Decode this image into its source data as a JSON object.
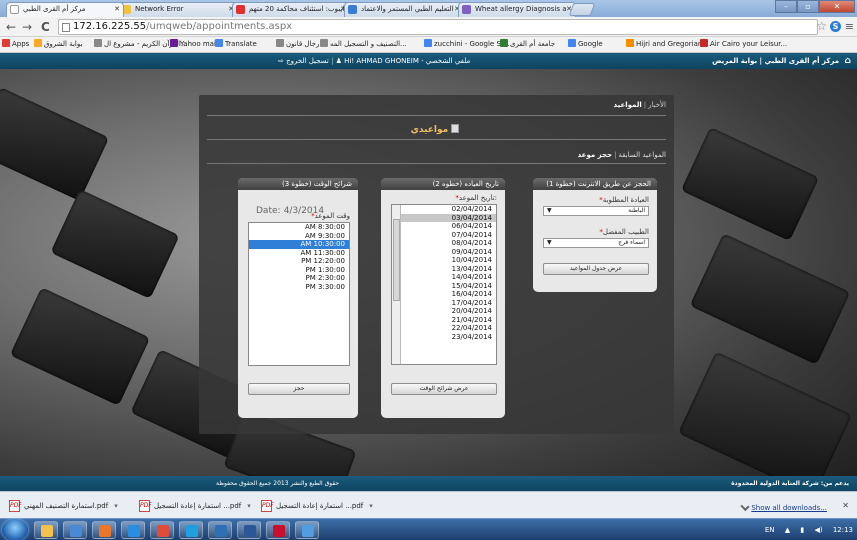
{
  "browser": {
    "tabs": [
      {
        "label": "مركز أم القرى الطبي",
        "icon_color": "#ffffff",
        "active": true
      },
      {
        "label": "Network Error",
        "icon_color": "#f0c040",
        "active": false
      },
      {
        "label": "ايبوب: استئناف محاكمة 20 متهم",
        "icon_color": "#e03030",
        "active": false
      },
      {
        "label": "التعليم الطبي المستمر والاعتماد",
        "icon_color": "#3a7bd5",
        "active": false
      },
      {
        "label": "Wheat allergy Diagnosis a",
        "icon_color": "#8060c0",
        "active": false
      }
    ],
    "window_controls": {
      "minimize": "–",
      "maximize": "▫",
      "close": "✕"
    },
    "nav": {
      "back": "←",
      "forward": "→",
      "reload": "C"
    },
    "url_host": "172.16.225.55",
    "url_path": "/umqweb/appointments.aspx",
    "star": "☆",
    "ext": "S",
    "menu": "≡",
    "bookmarks": [
      {
        "label": "Apps",
        "icon_color": "#e53935"
      },
      {
        "label": "بوابة الشروق",
        "icon_color": "#f9a825"
      },
      {
        "label": "القرآن الكريم - مشروع ال...",
        "icon_color": "#888888"
      },
      {
        "label": "Yahoo mail",
        "icon_color": "#6a1b9a"
      },
      {
        "label": "Translate",
        "icon_color": "#4285f4"
      },
      {
        "label": "رجال قانون",
        "icon_color": "#888888"
      },
      {
        "label": "التصنيف و التسجيل المه...",
        "icon_color": "#888888"
      },
      {
        "label": "zucchini - Google Se...",
        "icon_color": "#4285f4"
      },
      {
        "label": "جامعة أم القرى",
        "icon_color": "#2e7d32"
      },
      {
        "label": "Google",
        "icon_color": "#4285f4"
      },
      {
        "label": "Hijri and Gregorian ...",
        "icon_color": "#fb8c00"
      },
      {
        "label": "Air Cairo your Leisur...",
        "icon_color": "#c62828"
      }
    ]
  },
  "site": {
    "brand": "مركز أم القرى الطبي | بوابة المريض",
    "home_icon": "⌂",
    "user_text": "Hi! AHMAD GHONEIM - ملفي الشخصي",
    "logout": "تسجيل الخروج",
    "footer_left": "حقوق الطبع والنشر 2013 جميع الحقوق محفوظة",
    "footer_right": "يدعم من: شركة العناية الدولية المحدودة"
  },
  "panel": {
    "breadcrumb_news": "الأخبار",
    "breadcrumb_current": "المواعيد",
    "title": "مواعيدي",
    "subtab_book": "حجز موعد",
    "subtab_prev": "المواعيد السابقة",
    "step1": {
      "header": "الحجز عن طريق الانترنت (خطوة 1)",
      "clinic_label": "العيادة المطلوبة",
      "clinic_value": "الباطنة",
      "doctor_label": "الطبيب المفضل",
      "doctor_value": "اسماء فرج",
      "button": "عرض جدول المواعيد"
    },
    "step2": {
      "header": "تاريخ العياده (خطوه 2)",
      "date_label": "تاريخ الموعد:",
      "dates": [
        "02/04/2014",
        "03/04/2014",
        "06/04/2014",
        "07/04/2014",
        "08/04/2014",
        "09/04/2014",
        "10/04/2014",
        "13/04/2014",
        "14/04/2014",
        "15/04/2014",
        "16/04/2014",
        "17/04/2014",
        "20/04/2014",
        "21/04/2014",
        "22/04/2014",
        "23/04/2014"
      ],
      "highlighted_date": "03/04/2014",
      "button": "عرض شرائح الوقت"
    },
    "step3": {
      "header": "شرائح الوقت (خطوة 3)",
      "date_prefix": "Date:",
      "date_value": "4/3/2014",
      "time_label": "وقت الموعد",
      "times": [
        "AM 8:30:00",
        "AM 9:30:00",
        "AM 10:30:00",
        "AM 11:30:00",
        "PM 12:20:00",
        "PM 1:30:00",
        "PM 2:30:00",
        "PM 3:30:00"
      ],
      "selected_time": "AM 10:30:00",
      "button": "حجز"
    }
  },
  "downloads": {
    "items": [
      {
        "label": "استمارة التصنيف المهني.pdf",
        "icon": "PDF"
      },
      {
        "label": "استمارة إعادة التسجيل ...pdf",
        "icon": "PDF"
      },
      {
        "label": "استمارة إعادة التسجيل ...pdf",
        "icon": "PDF"
      }
    ],
    "dropdown": "▾",
    "show_all": "Show all downloads...",
    "close": "✕"
  },
  "taskbar": {
    "apps": [
      {
        "name": "explorer",
        "color": "#f2c14e"
      },
      {
        "name": "media",
        "color": "#4a8ad4"
      },
      {
        "name": "firefox",
        "color": "#e8762b"
      },
      {
        "name": "ie",
        "color": "#2a8ee0"
      },
      {
        "name": "chrome",
        "color": "#e04b3a"
      },
      {
        "name": "skype",
        "color": "#1ea0e0"
      },
      {
        "name": "app7",
        "color": "#2f6fb5"
      },
      {
        "name": "word",
        "color": "#2b5797"
      },
      {
        "name": "pdf",
        "color": "#c8102e"
      },
      {
        "name": "app10",
        "color": "#4f9de0"
      }
    ],
    "lang": "EN",
    "clock": "12:13"
  }
}
